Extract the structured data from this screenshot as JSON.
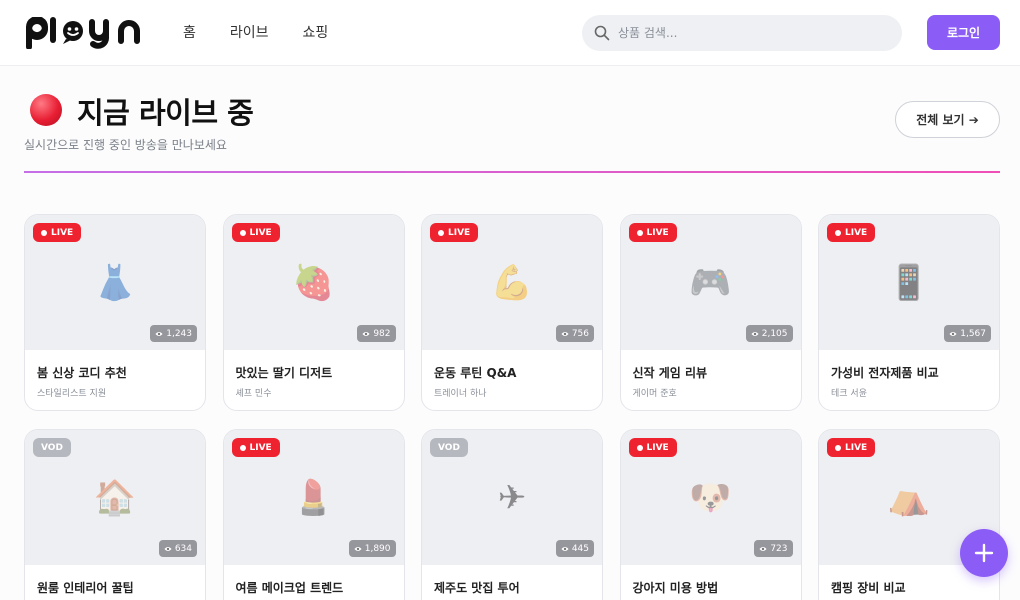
{
  "brand": {
    "logo_text": "ploYn",
    "accent": "#8c5cf6",
    "live_red": "#ef2330"
  },
  "nav": [
    {
      "label": "홈"
    },
    {
      "label": "라이브"
    },
    {
      "label": "쇼핑"
    }
  ],
  "search": {
    "placeholder": "상품 검색...",
    "icon": "search-icon"
  },
  "header": {
    "login_label": "로그인"
  },
  "section": {
    "title": "지금 라이브 중",
    "subtitle": "실시간으로 진행 중인 방송을 만나보세요",
    "view_all_label": "전체 보기 ➔"
  },
  "cards": [
    {
      "status": "LIVE",
      "icon": "dress-icon",
      "emoji": "👗",
      "viewers": "1,243",
      "title": "봄 신상 코디 추천",
      "host": "스타일리스트 지원"
    },
    {
      "status": "LIVE",
      "icon": "strawberry-icon",
      "emoji": "🍓",
      "viewers": "982",
      "title": "맛있는 딸기 디저트",
      "host": "셰프 민수"
    },
    {
      "status": "LIVE",
      "icon": "muscle-icon",
      "emoji": "💪",
      "viewers": "756",
      "title": "운동 루틴 Q&A",
      "host": "트레이너 하나"
    },
    {
      "status": "LIVE",
      "icon": "game-controller-icon",
      "emoji": "🎮",
      "viewers": "2,105",
      "title": "신작 게임 리뷰",
      "host": "게이머 준호"
    },
    {
      "status": "LIVE",
      "icon": "phone-icon",
      "emoji": "📱",
      "viewers": "1,567",
      "title": "가성비 전자제품 비교",
      "host": "테크 서윤"
    },
    {
      "status": "VOD",
      "icon": "house-icon",
      "emoji": "🏠",
      "viewers": "634",
      "title": "원룸 인테리어 꿀팁",
      "host": ""
    },
    {
      "status": "LIVE",
      "icon": "lipstick-icon",
      "emoji": "💄",
      "viewers": "1,890",
      "title": "여름 메이크업 트렌드",
      "host": ""
    },
    {
      "status": "VOD",
      "icon": "airplane-icon",
      "emoji": "✈",
      "viewers": "445",
      "title": "제주도 맛집 투어",
      "host": ""
    },
    {
      "status": "LIVE",
      "icon": "dog-icon",
      "emoji": "🐶",
      "viewers": "723",
      "title": "강아지 미용 방법",
      "host": ""
    },
    {
      "status": "LIVE",
      "icon": "tent-icon",
      "emoji": "⛺",
      "viewers": "",
      "title": "캠핑 장비 비교",
      "host": ""
    }
  ],
  "fab": {
    "icon": "plus-icon"
  }
}
